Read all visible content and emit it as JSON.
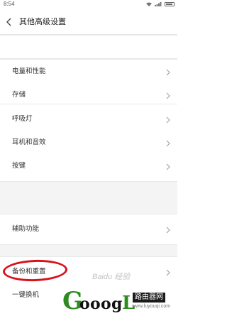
{
  "status_bar": {
    "time": "8:54",
    "icons": [
      "wifi-icon",
      "signal-icon",
      "battery-icon"
    ]
  },
  "header": {
    "title": "其他高级设置",
    "back_icon": "chevron-left-icon"
  },
  "groups": [
    {
      "items": [
        {
          "label": ""
        }
      ]
    },
    {
      "items": [
        {
          "label": "电量和性能"
        },
        {
          "label": "存储"
        }
      ]
    },
    {
      "items": [
        {
          "label": "呼吸灯"
        },
        {
          "label": "耳机和音效"
        },
        {
          "label": "按键"
        }
      ]
    },
    {
      "items": [
        {
          "label": "辅助功能"
        }
      ]
    },
    {
      "items": [
        {
          "label": "备份和重置"
        },
        {
          "label": "一键换机"
        }
      ]
    }
  ],
  "annotation": {
    "highlight_color": "#d8121a"
  },
  "watermark": {
    "baidu": "Baidu 经验",
    "logo": "GooogL",
    "site": "路由器网",
    "url": "www.luyouqi.com"
  }
}
